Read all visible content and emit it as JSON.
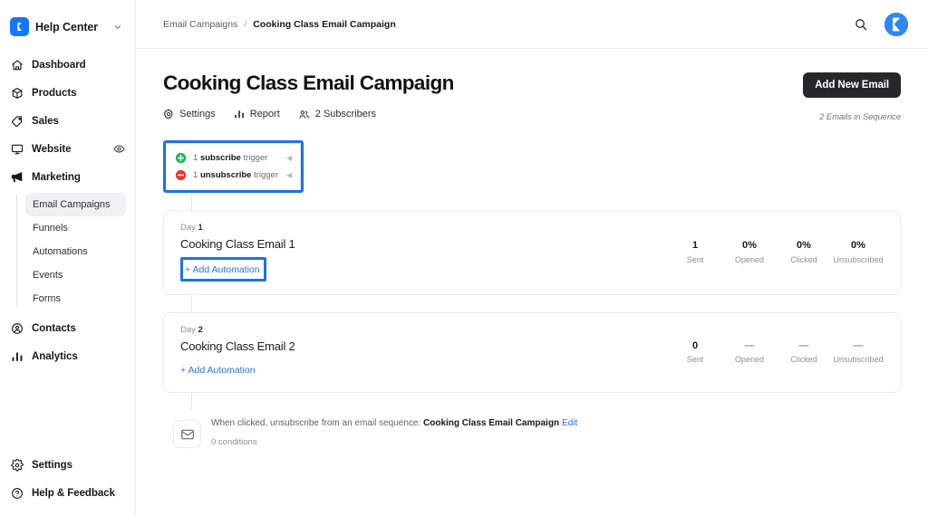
{
  "brand": {
    "name": "Help Center",
    "logo_icon": "app-logo-icon",
    "caret_icon": "chevron-down-icon"
  },
  "sidebar": {
    "items": [
      {
        "label": "Dashboard",
        "icon": "home-icon"
      },
      {
        "label": "Products",
        "icon": "box-icon"
      },
      {
        "label": "Sales",
        "icon": "tag-icon"
      },
      {
        "label": "Website",
        "icon": "monitor-icon",
        "trailing_icon": "eye-icon"
      },
      {
        "label": "Marketing",
        "icon": "megaphone-icon"
      }
    ],
    "marketing_children": [
      {
        "label": "Email Campaigns",
        "active": true
      },
      {
        "label": "Funnels",
        "active": false
      },
      {
        "label": "Automations",
        "active": false
      },
      {
        "label": "Events",
        "active": false
      },
      {
        "label": "Forms",
        "active": false
      }
    ],
    "items_after": [
      {
        "label": "Contacts",
        "icon": "contacts-icon"
      },
      {
        "label": "Analytics",
        "icon": "analytics-icon"
      }
    ],
    "bottom_items": [
      {
        "label": "Settings",
        "icon": "gear-icon"
      },
      {
        "label": "Help & Feedback",
        "icon": "question-circle-icon"
      }
    ]
  },
  "topbar": {
    "breadcrumb": {
      "parent": "Email Campaigns",
      "separator": "/",
      "current": "Cooking Class Email Campaign"
    },
    "search_icon": "search-icon",
    "avatar_icon": "user-avatar-icon"
  },
  "page": {
    "title": "Cooking Class Email Campaign",
    "primary_button": "Add New Email",
    "sequence_note": "2 Emails in Sequence",
    "tabs": [
      {
        "label": "Settings",
        "icon": "gear-icon"
      },
      {
        "label": "Report",
        "icon": "bar-chart-icon"
      },
      {
        "label": "2 Subscribers",
        "icon": "people-icon"
      }
    ]
  },
  "flow": {
    "triggers": [
      {
        "count": "1",
        "bold": "subscribe",
        "suffix": "trigger",
        "icon": "plus-circle-green-icon",
        "chevron": "chevron-icon"
      },
      {
        "count": "1",
        "bold": "unsubscribe",
        "suffix": "trigger",
        "icon": "minus-circle-red-icon",
        "chevron": "chevron-icon"
      }
    ],
    "stat_labels": [
      "Sent",
      "Opened",
      "Clicked",
      "Unsubscribed"
    ],
    "emails": [
      {
        "day_prefix": "Day",
        "day_number": "1",
        "name": "Cooking Class Email 1",
        "add_automation": "+ Add Automation",
        "highlighted": true,
        "stats": [
          "1",
          "0%",
          "0%",
          "0%"
        ]
      },
      {
        "day_prefix": "Day",
        "day_number": "2",
        "name": "Cooking Class Email 2",
        "add_automation": "+ Add Automation",
        "highlighted": false,
        "stats": [
          "0",
          "—",
          "—",
          "—"
        ]
      }
    ],
    "rule": {
      "icon": "envelope-icon",
      "text": "When clicked, unsubscribe from an email sequence:",
      "target": "Cooking Class Email Campaign",
      "edit_label": "Edit",
      "conditions": "0 conditions"
    }
  },
  "colors": {
    "accent_blue": "#1a73e8",
    "link_blue": "#2a74e0",
    "brand_blue": "#1478ff",
    "dark_button": "#26272b",
    "green": "#19b851",
    "red": "#e8393a"
  }
}
